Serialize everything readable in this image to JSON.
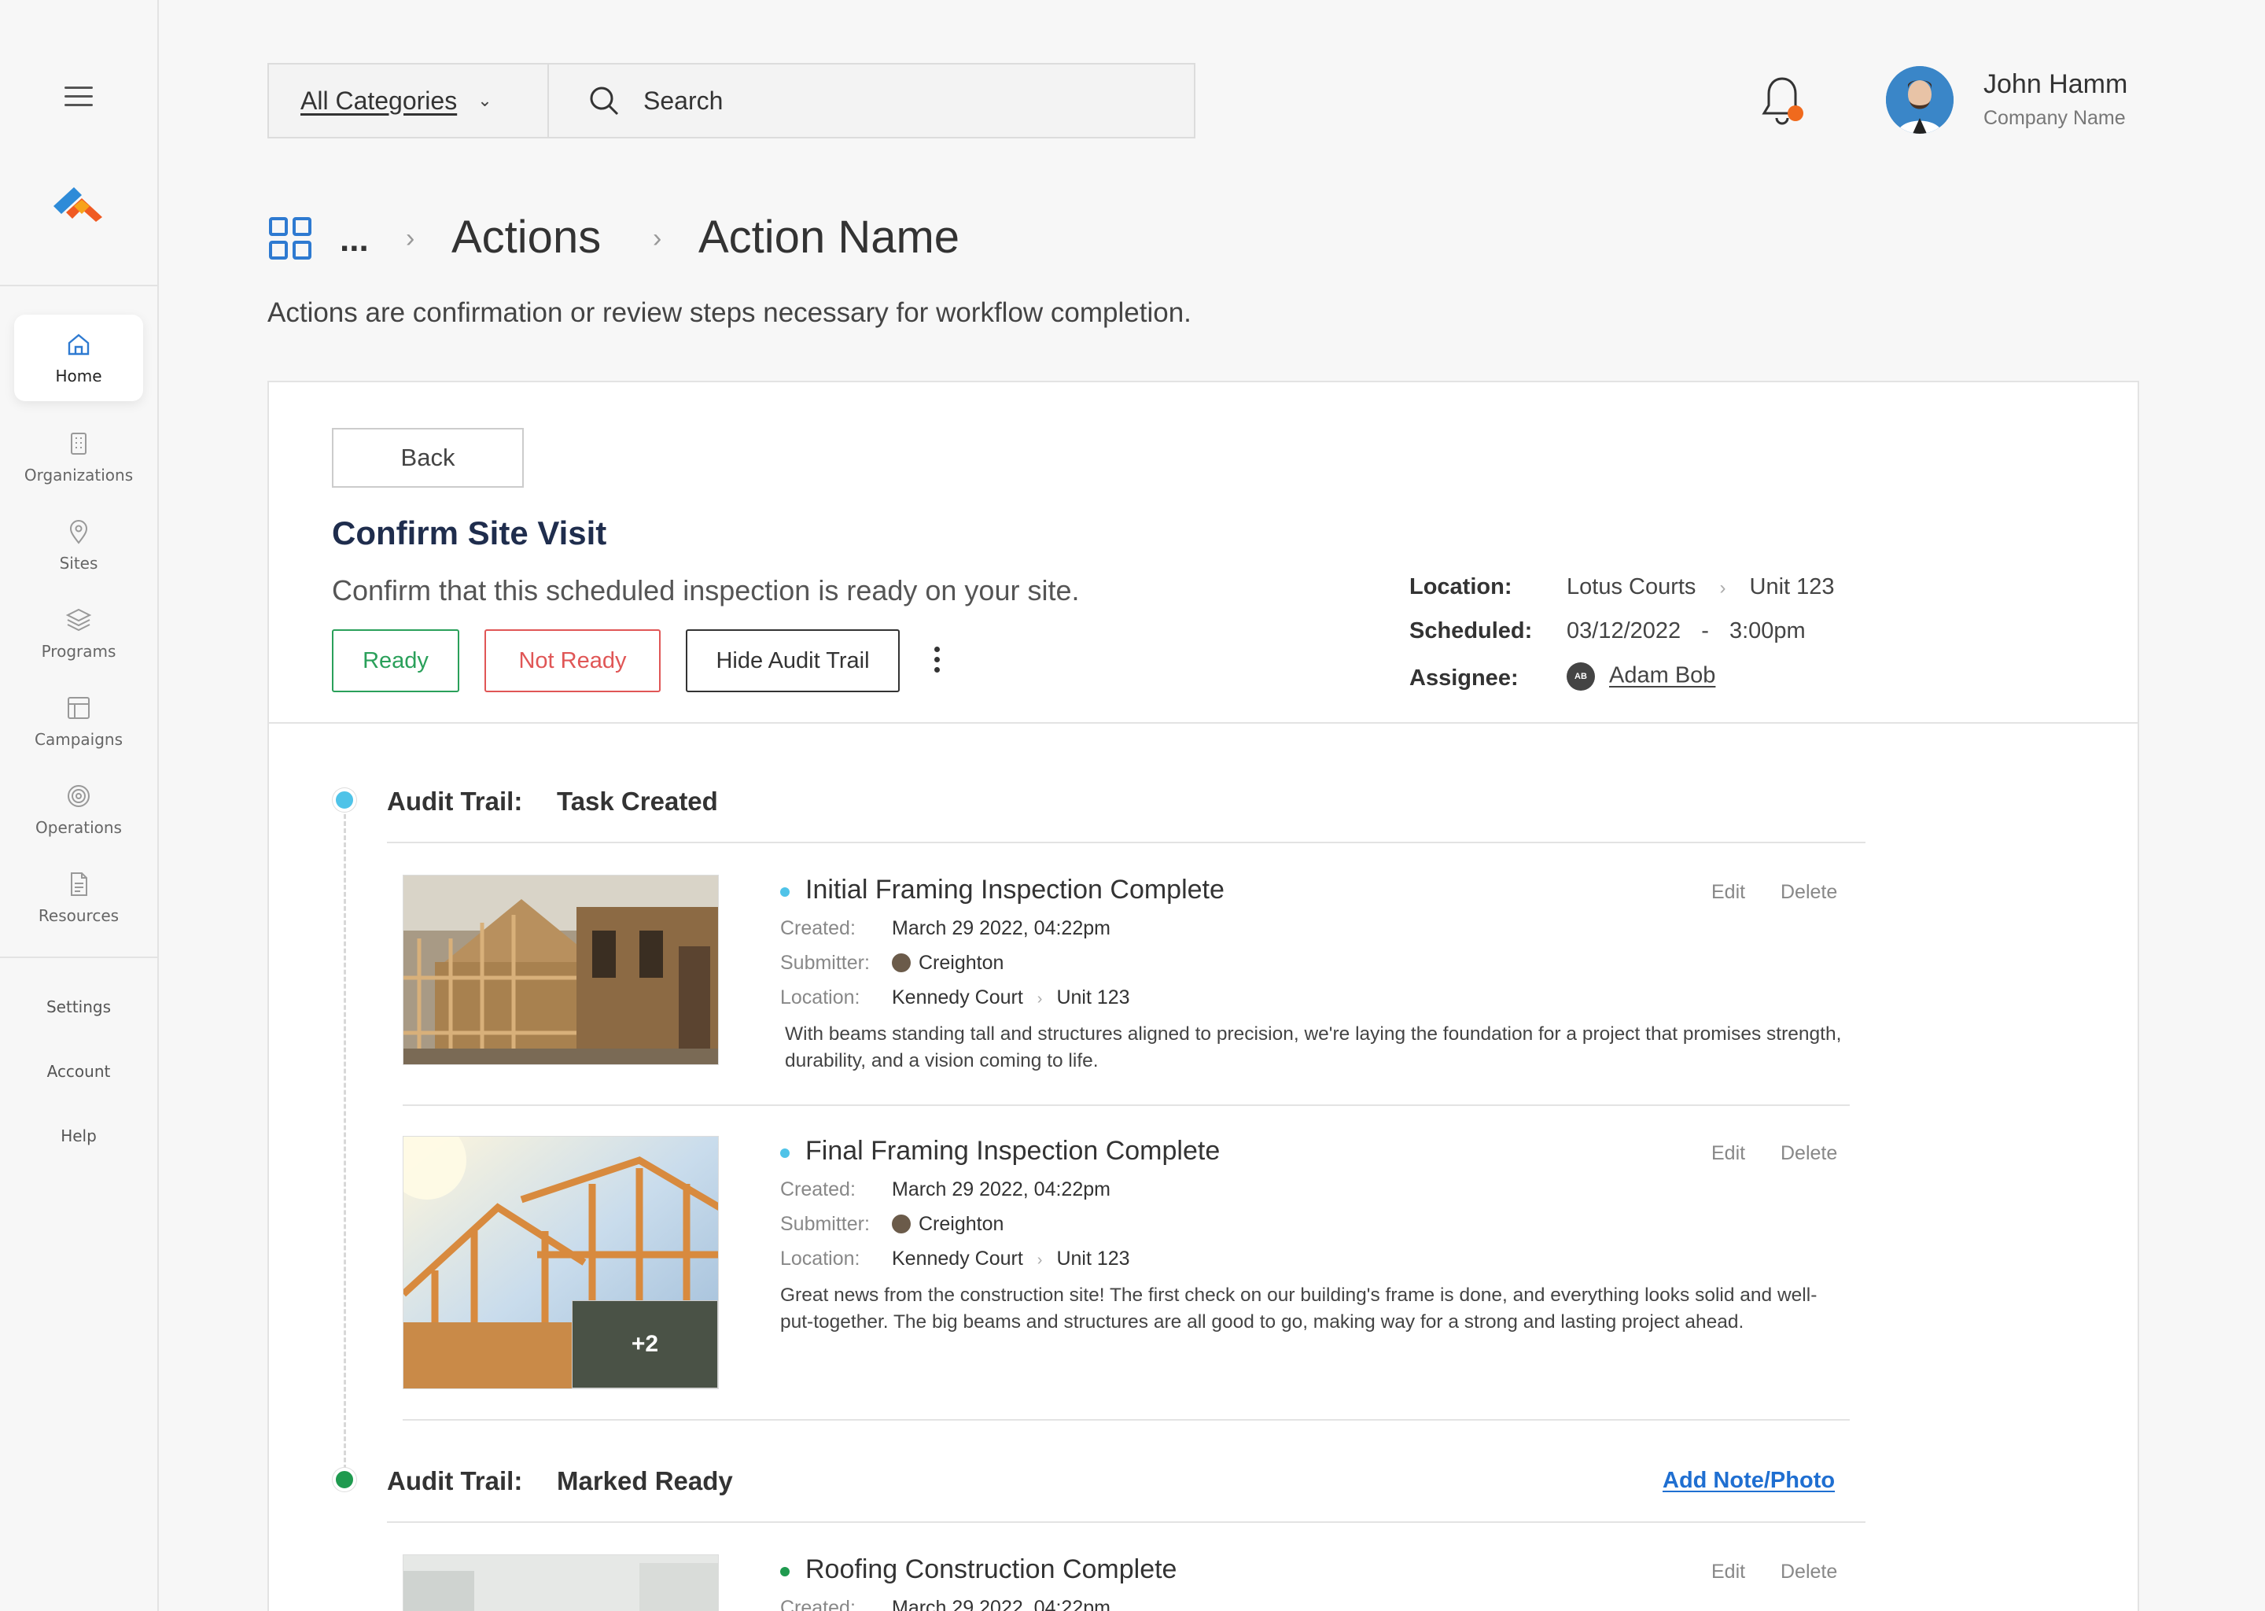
{
  "sidebar": {
    "items": [
      {
        "label": "Home",
        "icon": "home-icon"
      },
      {
        "label": "Organizations",
        "icon": "building-icon"
      },
      {
        "label": "Sites",
        "icon": "location-pin-icon"
      },
      {
        "label": "Programs",
        "icon": "layers-icon"
      },
      {
        "label": "Campaigns",
        "icon": "layout-icon"
      },
      {
        "label": "Operations",
        "icon": "target-icon"
      },
      {
        "label": "Resources",
        "icon": "document-icon"
      }
    ],
    "links": [
      "Settings",
      "Account",
      "Help"
    ]
  },
  "topbar": {
    "category_label": "All Categories",
    "search_placeholder": "Search",
    "user_name": "John Hamm",
    "company": "Company Name"
  },
  "breadcrumb": {
    "ellipsis": "...",
    "section": "Actions",
    "current": "Action Name"
  },
  "page_description": "Actions are confirmation or review steps necessary for workflow completion.",
  "task": {
    "back_label": "Back",
    "title": "Confirm Site Visit",
    "description": "Confirm that this scheduled inspection is ready on your site.",
    "ready_label": "Ready",
    "not_ready_label": "Not Ready",
    "hide_audit_label": "Hide Audit Trail",
    "location_label": "Location:",
    "location_site": "Lotus Courts",
    "location_unit": "Unit 123",
    "scheduled_label": "Scheduled:",
    "scheduled_date": "03/12/2022",
    "scheduled_dash": "-",
    "scheduled_time": "3:00pm",
    "assignee_label": "Assignee:",
    "assignee_initials": "AB",
    "assignee_name": "Adam Bob"
  },
  "audit": [
    {
      "title": "Audit Trail:",
      "status": "Task Created",
      "dot_color": "#4fc3e8",
      "items": [
        {
          "title": "Initial Framing Inspection Complete",
          "bullet_color": "#4fc3e8",
          "created_label": "Created:",
          "created": "March 29 2022, 04:22pm",
          "submitter_label": "Submitter:",
          "submitter": "Creighton",
          "location_label": "Location:",
          "location_site": "Kennedy Court",
          "location_unit": "Unit 123",
          "body": "With beams standing tall and structures aligned to precision, we're laying the foundation for a project that promises strength, durability, and a vision coming to life.",
          "edit": "Edit",
          "delete": "Delete"
        },
        {
          "title": "Final Framing Inspection Complete",
          "bullet_color": "#4fc3e8",
          "created_label": "Created:",
          "created": "March 29 2022, 04:22pm",
          "submitter_label": "Submitter:",
          "submitter": "Creighton",
          "location_label": "Location:",
          "location_site": "Kennedy Court",
          "location_unit": "Unit 123",
          "body": "Great news from the construction site! The first check on our building's frame is done, and everything looks solid and well-put-together. The big beams and structures are all good to go, making way for a strong and lasting project ahead.",
          "more_photos": "+2",
          "edit": "Edit",
          "delete": "Delete"
        }
      ]
    },
    {
      "title": "Audit Trail:",
      "status": "Marked Ready",
      "dot_color": "#1f9a4f",
      "add_note": "Add Note/Photo",
      "items": [
        {
          "title": "Roofing Construction Complete",
          "bullet_color": "#1f9a4f",
          "created_label": "Created:",
          "created": "March 29 2022, 04:22pm",
          "edit": "Edit",
          "delete": "Delete"
        }
      ]
    }
  ],
  "colors": {
    "ready": "#2aa05a",
    "not_ready": "#e05656",
    "link": "#1f6fd1",
    "title": "#1f2d4d",
    "notification": "#f06a1d"
  }
}
